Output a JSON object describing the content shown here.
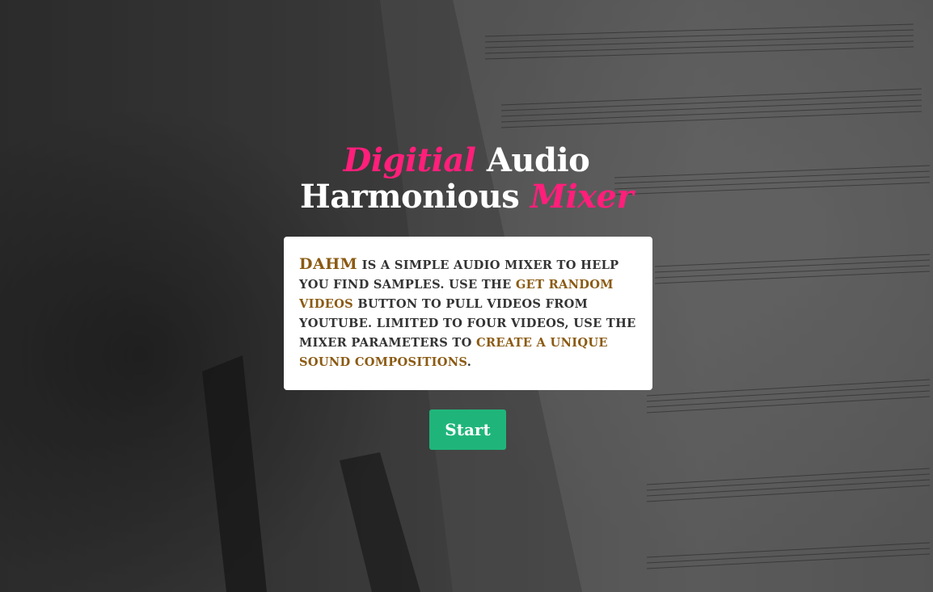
{
  "hero": {
    "title_part1": "Digitial",
    "title_part2": " Audio",
    "title_part3": "Harmonious ",
    "title_part4": "Mixer"
  },
  "intro": {
    "brand": "DAHM",
    "text1": " is a simple audio mixer to help you find samples. Use the ",
    "link1": "Get Random Videos",
    "text2": " button to pull videos from YouTube. Limited to four videos, use the mixer parameters to ",
    "link2": "create a unique sound compositions",
    "text3": "."
  },
  "actions": {
    "start_label": "Start"
  },
  "colors": {
    "accent": "#ff1f7a",
    "highlight": "#8b5a12",
    "button": "#1fb57a"
  }
}
